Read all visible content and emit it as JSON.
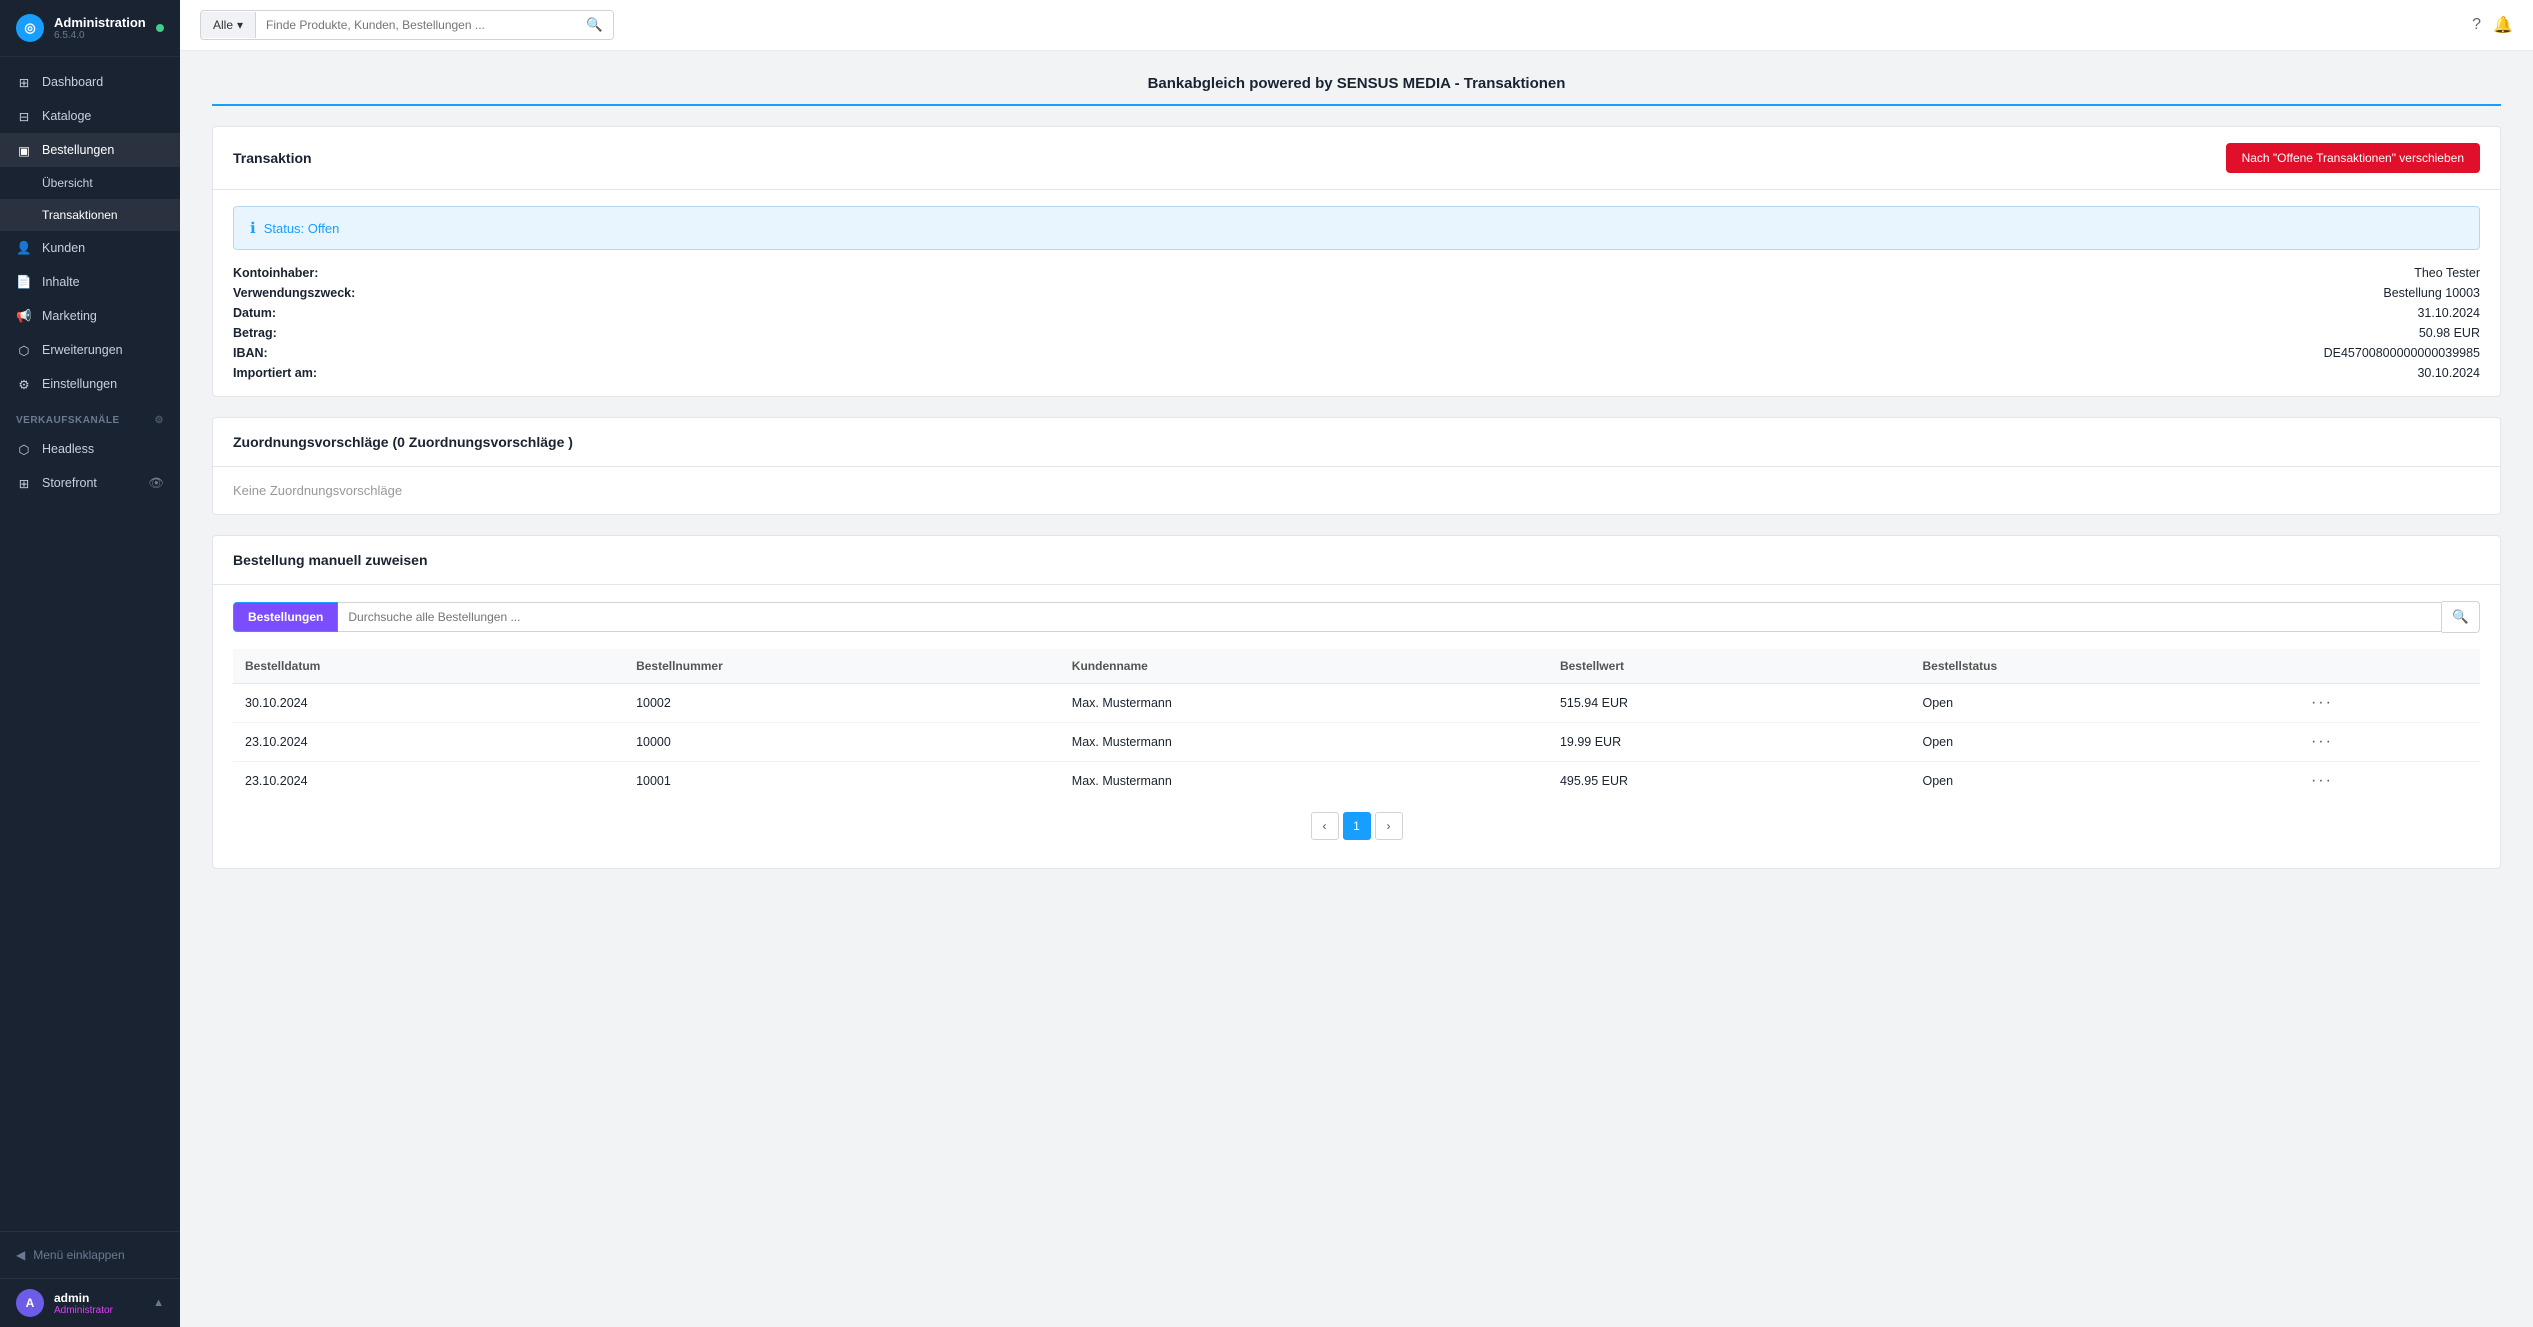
{
  "app": {
    "name": "Administration",
    "version": "6.5.4.0",
    "status_dot_color": "#44cc88"
  },
  "sidebar": {
    "nav_items": [
      {
        "id": "dashboard",
        "label": "Dashboard",
        "icon": "grid"
      },
      {
        "id": "kataloge",
        "label": "Kataloge",
        "icon": "book"
      },
      {
        "id": "bestellungen",
        "label": "Bestellungen",
        "icon": "box",
        "active": true
      },
      {
        "id": "uebersicht",
        "label": "Übersicht",
        "sub": true
      },
      {
        "id": "transaktionen",
        "label": "Transaktionen",
        "sub": true,
        "active": true
      },
      {
        "id": "kunden",
        "label": "Kunden",
        "icon": "person"
      },
      {
        "id": "inhalte",
        "label": "Inhalte",
        "icon": "file"
      },
      {
        "id": "marketing",
        "label": "Marketing",
        "icon": "megaphone"
      },
      {
        "id": "erweiterungen",
        "label": "Erweiterungen",
        "icon": "puzzle"
      },
      {
        "id": "einstellungen",
        "label": "Einstellungen",
        "icon": "gear"
      }
    ],
    "sales_section": "Verkaufskanäle",
    "sales_items": [
      {
        "id": "headless",
        "label": "Headless"
      },
      {
        "id": "storefront",
        "label": "Storefront"
      }
    ],
    "collapse_label": "Menü einklappen",
    "user": {
      "name": "admin",
      "role": "Administrator",
      "avatar_letter": "A"
    }
  },
  "topbar": {
    "search_filter": "Alle",
    "search_placeholder": "Finde Produkte, Kunden, Bestellungen ...",
    "chevron": "▾"
  },
  "page": {
    "title": "Bankabgleich powered by SENSUS MEDIA - Transaktionen"
  },
  "transaction_card": {
    "title": "Transaktion",
    "move_button": "Nach \"Offene Transaktionen\" verschieben",
    "status_label": "Status: Offen",
    "fields": [
      {
        "label": "Kontoinhaber:",
        "value": "Theo Tester"
      },
      {
        "label": "Verwendungszweck:",
        "value": "Bestellung 10003"
      },
      {
        "label": "Datum:",
        "value": "31.10.2024"
      },
      {
        "label": "Betrag:",
        "value": "50.98 EUR"
      },
      {
        "label": "IBAN:",
        "value": "DE45700800000000039985"
      },
      {
        "label": "Importiert am:",
        "value": "30.10.2024"
      }
    ]
  },
  "zuordnung_card": {
    "title": "Zuordnungsvorschläge (0 Zuordnungsvorschläge )",
    "empty_message": "Keine Zuordnungsvorschläge"
  },
  "manual_assign_card": {
    "title": "Bestellung manuell zuweisen",
    "search_tab_label": "Bestellungen",
    "search_placeholder": "Durchsuche alle Bestellungen ...",
    "table_headers": [
      "Bestelldatum",
      "Bestellnummer",
      "Kundenname",
      "Bestellwert",
      "Bestellstatus",
      ""
    ],
    "table_rows": [
      {
        "date": "30.10.2024",
        "number": "10002",
        "customer": "Max. Mustermann",
        "value": "515.94 EUR",
        "status": "Open"
      },
      {
        "date": "23.10.2024",
        "number": "10000",
        "customer": "Max. Mustermann",
        "value": "19.99 EUR",
        "status": "Open"
      },
      {
        "date": "23.10.2024",
        "number": "10001",
        "customer": "Max. Mustermann",
        "value": "495.95 EUR",
        "status": "Open"
      }
    ],
    "pagination_current": "1"
  }
}
